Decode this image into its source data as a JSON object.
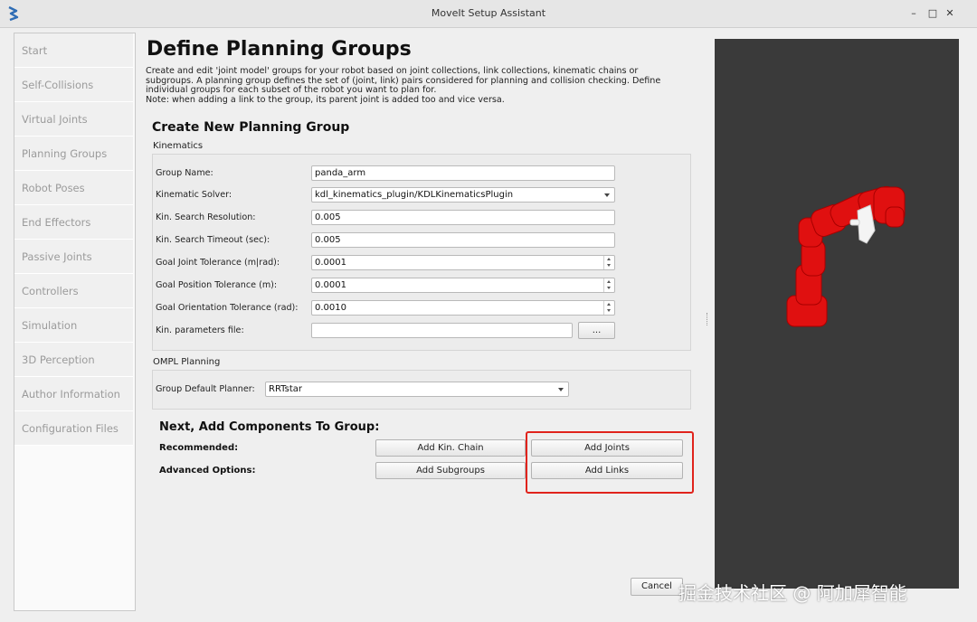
{
  "window": {
    "title": "MoveIt Setup Assistant",
    "controls": {
      "minimize": "–",
      "maximize": "□",
      "close": "✕"
    }
  },
  "sidebar": {
    "items": [
      {
        "label": "Start"
      },
      {
        "label": "Self-Collisions"
      },
      {
        "label": "Virtual Joints"
      },
      {
        "label": "Planning Groups"
      },
      {
        "label": "Robot Poses"
      },
      {
        "label": "End Effectors"
      },
      {
        "label": "Passive Joints"
      },
      {
        "label": "Controllers"
      },
      {
        "label": "Simulation"
      },
      {
        "label": "3D Perception"
      },
      {
        "label": "Author Information"
      },
      {
        "label": "Configuration Files"
      }
    ]
  },
  "main": {
    "title": "Define Planning Groups",
    "description": "Create and edit 'joint model' groups for your robot based on joint collections, link collections, kinematic chains or\nsubgroups. A planning group defines the set of (joint, link) pairs considered for planning and collision checking. Define\nindividual groups for each subset of the robot you want to plan for.\nNote: when adding a link to the group, its parent joint is added too and vice versa.",
    "section_title": "Create New Planning Group",
    "kinematics": {
      "label": "Kinematics",
      "group_name_label": "Group Name:",
      "group_name_value": "panda_arm",
      "solver_label": "Kinematic Solver:",
      "solver_value": "kdl_kinematics_plugin/KDLKinematicsPlugin",
      "resolution_label": "Kin. Search Resolution:",
      "resolution_value": "0.005",
      "timeout_label": "Kin. Search Timeout (sec):",
      "timeout_value": "0.005",
      "joint_tol_label": "Goal Joint Tolerance (m|rad):",
      "joint_tol_value": "0.0001",
      "pos_tol_label": "Goal Position Tolerance (m):",
      "pos_tol_value": "0.0001",
      "orient_tol_label": "Goal Orientation Tolerance (rad):",
      "orient_tol_value": "0.0010",
      "params_file_label": "Kin. parameters file:",
      "params_file_value": "",
      "browse_label": "..."
    },
    "ompl": {
      "label": "OMPL Planning",
      "planner_label": "Group Default Planner:",
      "planner_value": "RRTstar"
    },
    "components": {
      "title": "Next, Add Components To Group:",
      "recommended_label": "Recommended:",
      "advanced_label": "Advanced Options:",
      "add_kin_chain": "Add Kin. Chain",
      "add_joints": "Add Joints",
      "add_subgroups": "Add Subgroups",
      "add_links": "Add Links"
    },
    "cancel_label": "Cancel"
  },
  "watermark": "掘金技术社区 @ 阿加犀智能",
  "colors": {
    "highlight": "#e0231c",
    "robot": "#e01010",
    "viewer_bg": "#3a3a3a"
  }
}
